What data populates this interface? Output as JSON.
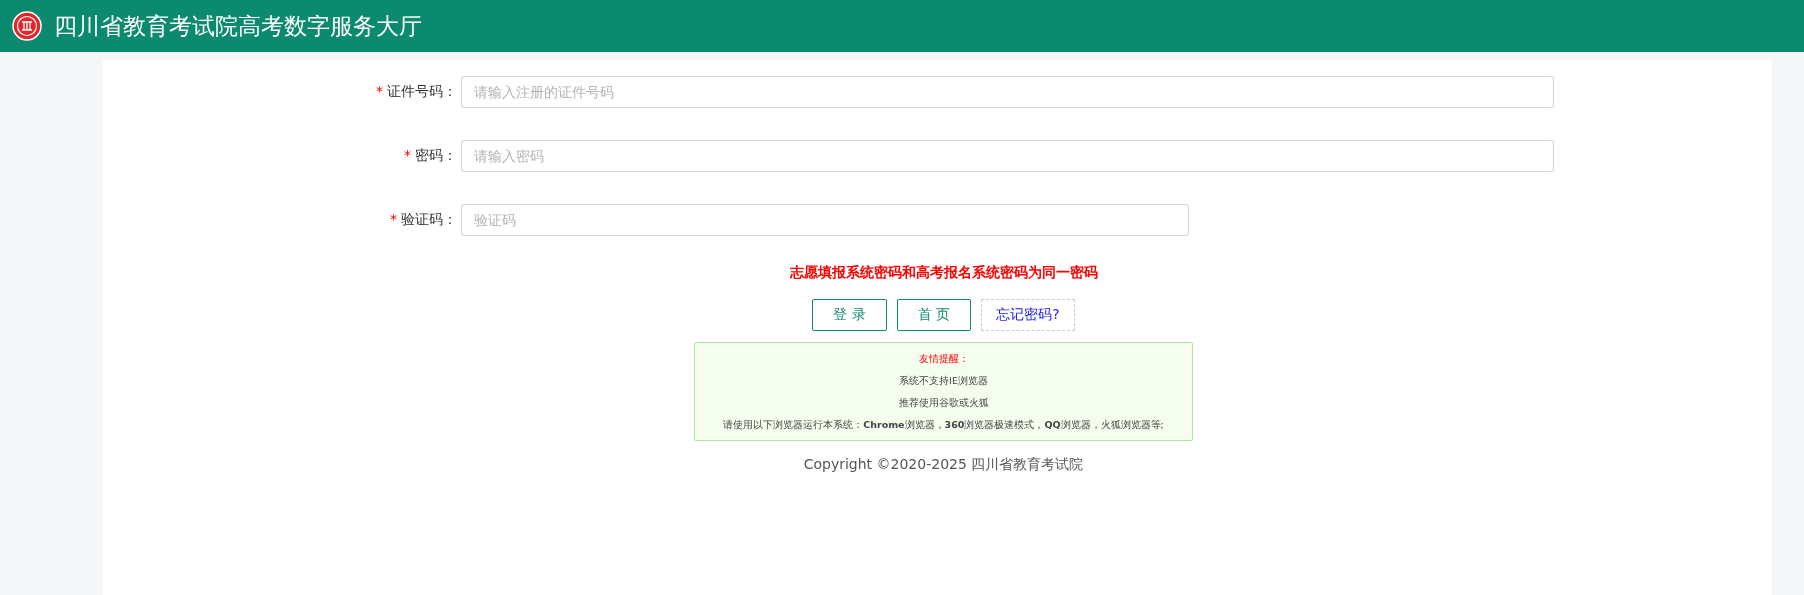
{
  "header": {
    "title": "四川省教育考试院高考数字服务大厅"
  },
  "fields": [
    {
      "marker": "*",
      "label": "证件号码：",
      "placeholder": "请输入注册的证件号码",
      "kind": "wide"
    },
    {
      "marker": "*",
      "label": "密码：",
      "placeholder": "请输入密码",
      "kind": "wide"
    },
    {
      "marker": "*",
      "label": "验证码：",
      "placeholder": "验证码",
      "kind": "short"
    }
  ],
  "notice": "志愿填报系统密码和高考报名系统密码为同一密码",
  "buttons": [
    {
      "label": "登 录",
      "kind": "primary"
    },
    {
      "label": "首 页",
      "kind": "primary"
    },
    {
      "label": "忘记密码?",
      "kind": "link"
    }
  ],
  "tips": {
    "title": "友情提醒：",
    "lines": [
      "系统不支持IE浏览器",
      "推荐使用谷歌或火狐",
      "请使用以下浏览器运行本系统：**Chrome**浏览器，**360**浏览器极速模式，**QQ**浏览器，火狐浏览器等;"
    ]
  },
  "footer": "Copyright ©2020-2025 四川省教育考试院"
}
